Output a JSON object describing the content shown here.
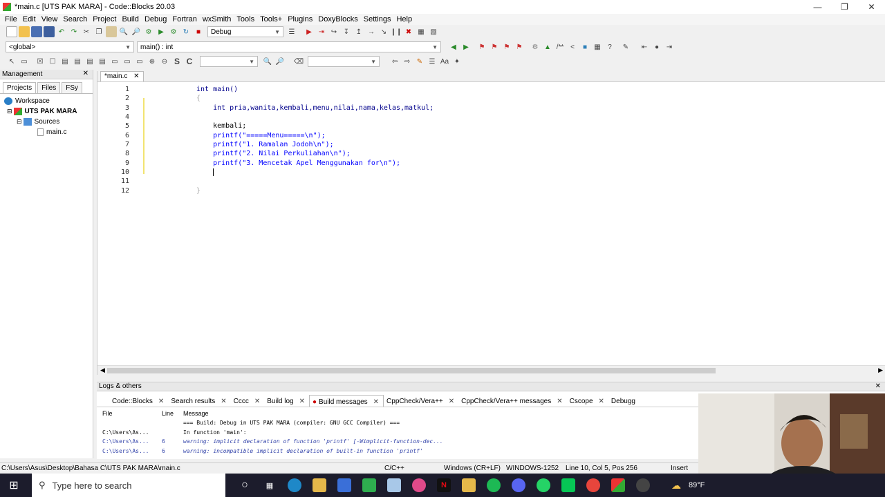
{
  "window": {
    "title": "*main.c [UTS PAK MARA] - Code::Blocks 20.03"
  },
  "menu": [
    "File",
    "Edit",
    "View",
    "Search",
    "Project",
    "Build",
    "Debug",
    "Fortran",
    "wxSmith",
    "Tools",
    "Tools+",
    "Plugins",
    "DoxyBlocks",
    "Settings",
    "Help"
  ],
  "toolbar": {
    "build_target": "Debug",
    "scope": "<global>",
    "function": "main() : int"
  },
  "management": {
    "title": "Management",
    "tabs": [
      "Projects",
      "Files",
      "FSy"
    ],
    "workspace": "Workspace",
    "project": "UTS PAK MARA",
    "folder": "Sources",
    "file": "main.c"
  },
  "editor": {
    "tab": "*main.c",
    "lines": [
      "1",
      "2",
      "3",
      "4",
      "5",
      "6",
      "7",
      "8",
      "9",
      "10",
      "11",
      "12"
    ],
    "code": {
      "l1": "int main()",
      "l2": "{",
      "l3": "    int pria,wanita,kembali,menu,nilai,nama,kelas,matkul;",
      "l5": "    kembali;",
      "l6": "    printf(\"=====Menu=====\\n\");",
      "l7": "    printf(\"1. Ramalan Jodoh\\n\");",
      "l8": "    printf(\"2. Nilai Perkuliahan\\n\");",
      "l9": "    printf(\"3. Mencetak Apel Menggunakan for\\n\");",
      "l12": "}"
    }
  },
  "logs": {
    "title": "Logs & others",
    "tabs": [
      "Code::Blocks",
      "Search results",
      "Cccc",
      "Build log",
      "Build messages",
      "CppCheck/Vera++",
      "CppCheck/Vera++ messages",
      "Cscope",
      "Debugg"
    ],
    "columns": [
      "File",
      "Line",
      "Message"
    ],
    "rows": [
      {
        "file": "",
        "line": "",
        "msg": "=== Build: Debug in UTS PAK MARA (compiler: GNU GCC Compiler) ==="
      },
      {
        "file": "C:\\Users\\As...",
        "line": "",
        "msg": "In function 'main':"
      },
      {
        "file": "C:\\Users\\As...",
        "line": "6",
        "msg": "warning: implicit declaration of function 'printf' [-Wimplicit-function-dec..."
      },
      {
        "file": "C:\\Users\\As...",
        "line": "6",
        "msg": "warning: incompatible implicit declaration of built-in function 'printf'"
      }
    ]
  },
  "status": {
    "path": "C:\\Users\\Asus\\Desktop\\Bahasa C\\UTS PAK MARA\\main.c",
    "lang": "C/C++",
    "eol": "Windows (CR+LF)",
    "enc": "WINDOWS-1252",
    "pos": "Line 10, Col 5, Pos 256",
    "mode": "Insert"
  },
  "taskbar": {
    "search_placeholder": "Type here to search",
    "temp": "89°F"
  }
}
